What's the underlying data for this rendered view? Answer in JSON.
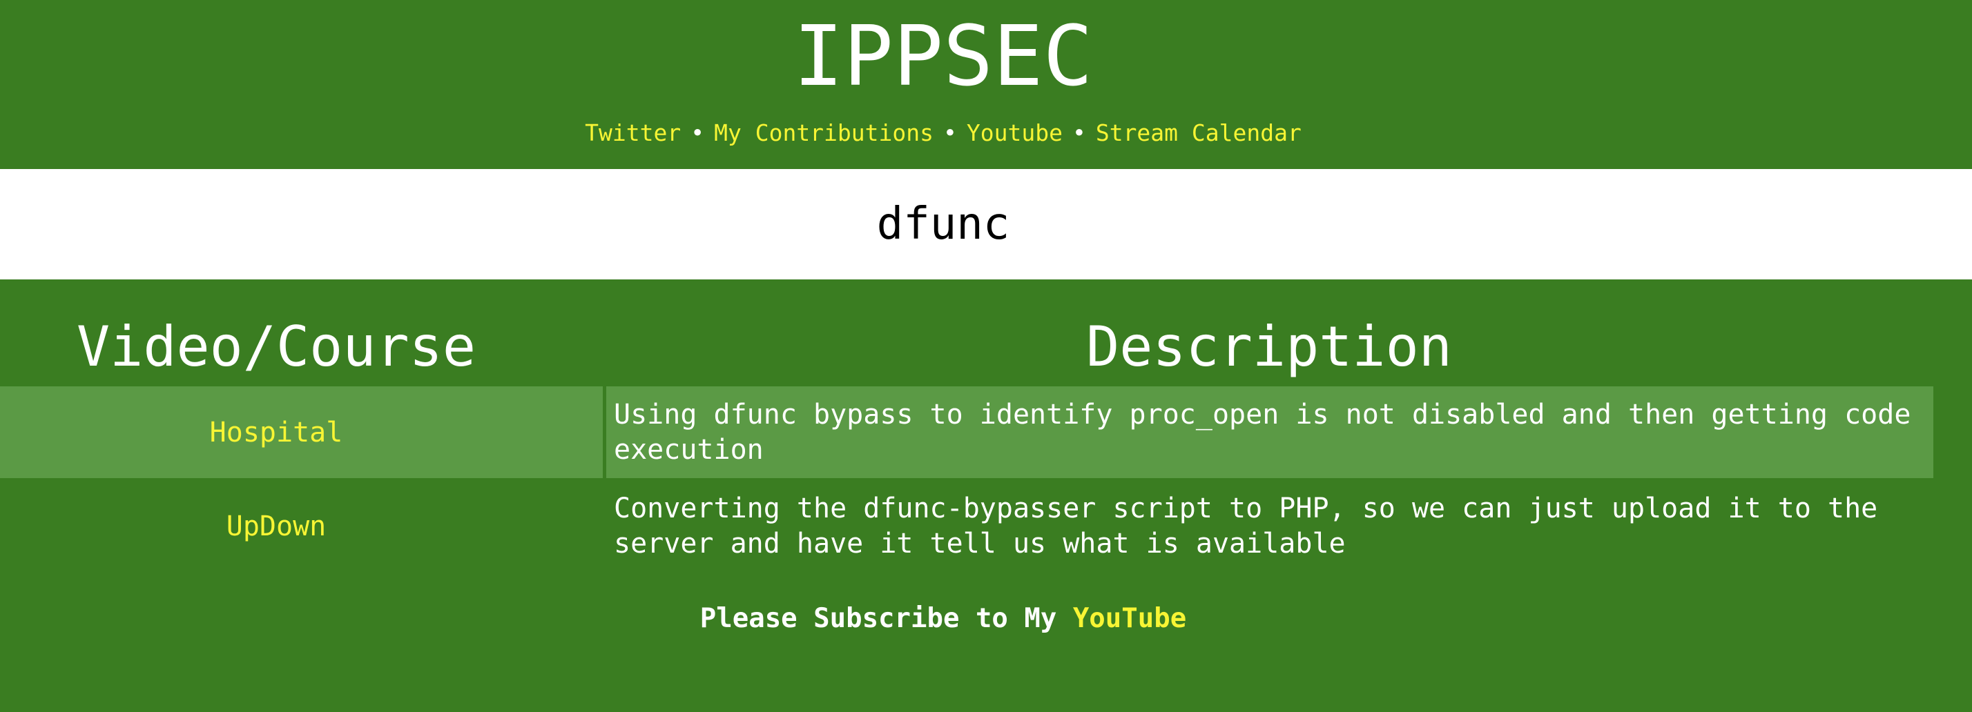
{
  "header": {
    "title": "IPPSEC",
    "nav": [
      {
        "label": "Twitter"
      },
      {
        "label": "My Contributions"
      },
      {
        "label": "Youtube"
      },
      {
        "label": "Stream Calendar"
      }
    ],
    "separator": "•"
  },
  "search": {
    "value": "dfunc",
    "placeholder": ""
  },
  "table": {
    "headers": [
      "Video/Course",
      "Description"
    ],
    "rows": [
      {
        "video": "Hospital",
        "description": "Using dfunc bypass to identify proc_open is not disabled and then getting code execution"
      },
      {
        "video": "UpDown",
        "description": "Converting the dfunc-bypasser script to PHP, so we can just upload it to the server and have it tell us what is available"
      }
    ]
  },
  "footer": {
    "text": "Please Subscribe to My ",
    "link": "YouTube"
  },
  "colors": {
    "background": "#3a7d21",
    "highlight_row": "#5b9a45",
    "link": "#f8f534",
    "text": "#ffffff",
    "search_background": "#ffffff"
  }
}
